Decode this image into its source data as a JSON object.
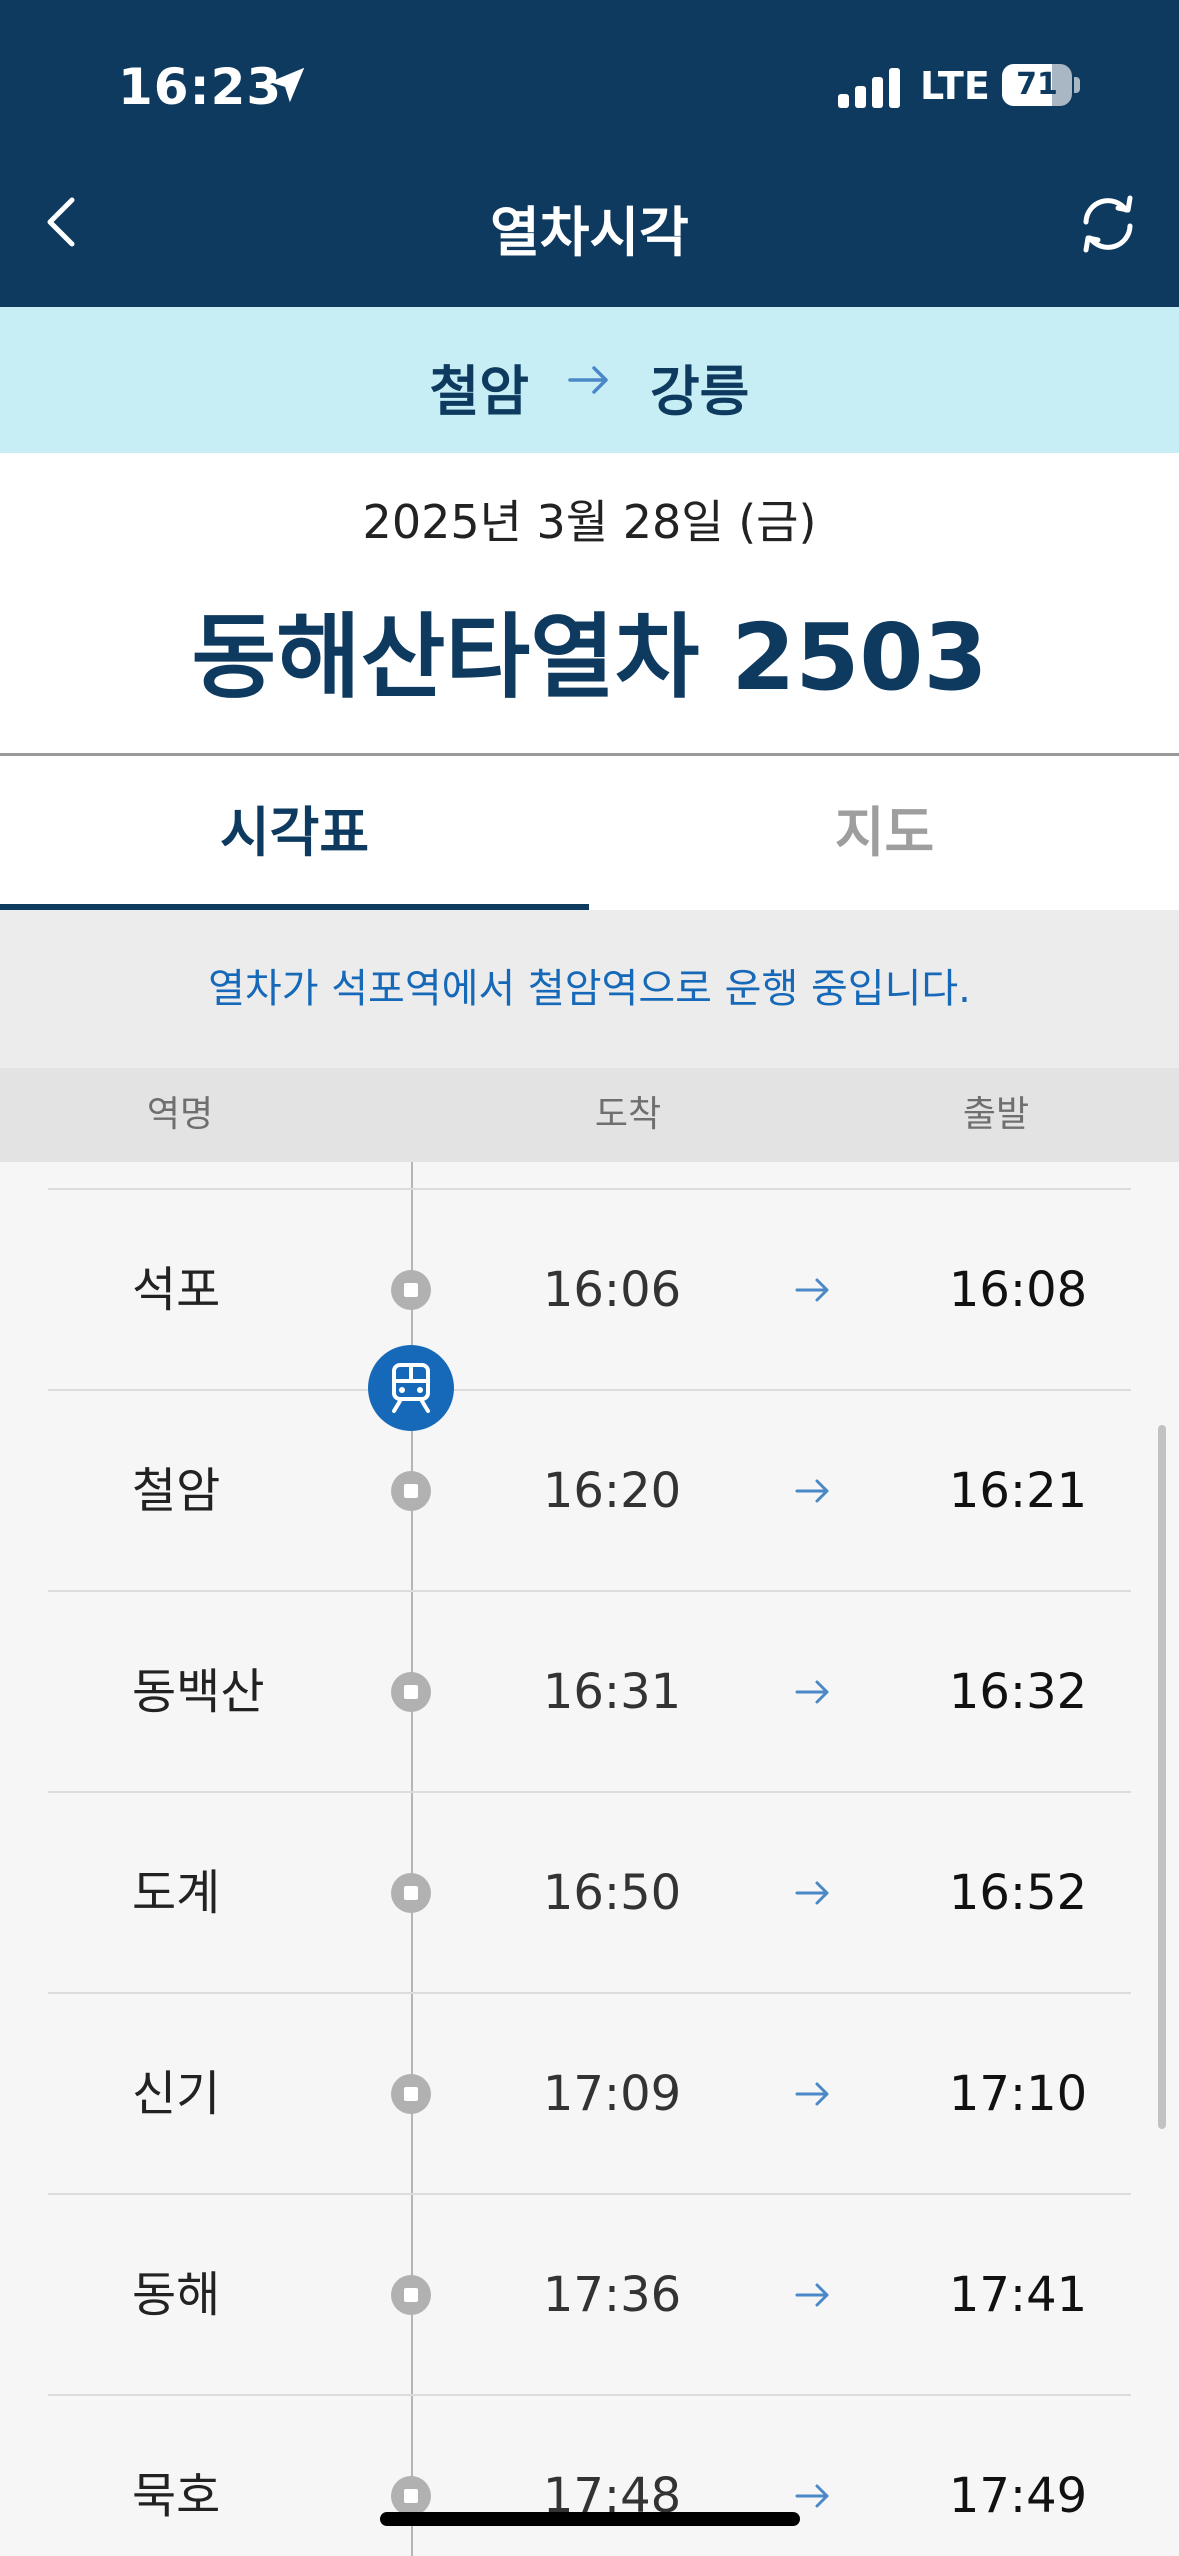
{
  "status_bar": {
    "time": "16:23",
    "carrier": "LTE",
    "battery_level": "71",
    "battery_fraction": 0.71,
    "icons": [
      "location-arrow-icon",
      "signal-icon",
      "battery-icon"
    ]
  },
  "nav": {
    "title": "열차시각",
    "back_icon": "chevron-left-icon",
    "refresh_icon": "refresh-icon"
  },
  "route": {
    "from": "철암",
    "to": "강릉",
    "arrow_icon": "arrow-right-icon"
  },
  "trip": {
    "date": "2025년 3월 28일 (금)",
    "train_name": "동해산타열차 2503"
  },
  "tabs": [
    {
      "label": "시각표",
      "active": true
    },
    {
      "label": "지도",
      "active": false
    }
  ],
  "notice": "열차가 석포역에서 철암역으로 운행 중입니다.",
  "columns": {
    "station": "역명",
    "arrival": "도착",
    "departure": "출발"
  },
  "stops": [
    {
      "station": "석포",
      "arrival": "16:06",
      "departure": "16:08"
    },
    {
      "station": "철암",
      "arrival": "16:20",
      "departure": "16:21"
    },
    {
      "station": "동백산",
      "arrival": "16:31",
      "departure": "16:32"
    },
    {
      "station": "도계",
      "arrival": "16:50",
      "departure": "16:52"
    },
    {
      "station": "신기",
      "arrival": "17:09",
      "departure": "17:10"
    },
    {
      "station": "동해",
      "arrival": "17:36",
      "departure": "17:41"
    },
    {
      "station": "묵호",
      "arrival": "17:48",
      "departure": "17:49"
    }
  ],
  "colors": {
    "header": "#0e3a5f",
    "route_bar": "#c6eef4",
    "accent_blue": "#1669b8",
    "tab_inactive": "#9e9e9e"
  }
}
